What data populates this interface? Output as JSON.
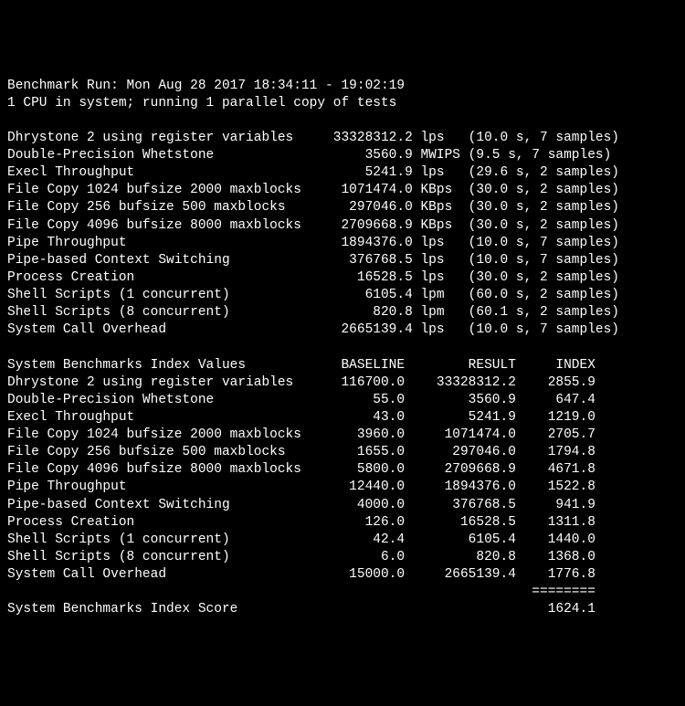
{
  "header": {
    "run_line": "Benchmark Run: Mon Aug 28 2017 18:34:11 - 19:02:19",
    "cpu_line": "1 CPU in system; running 1 parallel copy of tests"
  },
  "raw_results": [
    {
      "name": "Dhrystone 2 using register variables",
      "value": "33328312.2",
      "unit": "lps",
      "time": "10.0 s",
      "samples": "7 samples"
    },
    {
      "name": "Double-Precision Whetstone",
      "value": "3560.9",
      "unit": "MWIPS",
      "time": "9.5 s",
      "samples": "7 samples"
    },
    {
      "name": "Execl Throughput",
      "value": "5241.9",
      "unit": "lps",
      "time": "29.6 s",
      "samples": "2 samples"
    },
    {
      "name": "File Copy 1024 bufsize 2000 maxblocks",
      "value": "1071474.0",
      "unit": "KBps",
      "time": "30.0 s",
      "samples": "2 samples"
    },
    {
      "name": "File Copy 256 bufsize 500 maxblocks",
      "value": "297046.0",
      "unit": "KBps",
      "time": "30.0 s",
      "samples": "2 samples"
    },
    {
      "name": "File Copy 4096 bufsize 8000 maxblocks",
      "value": "2709668.9",
      "unit": "KBps",
      "time": "30.0 s",
      "samples": "2 samples"
    },
    {
      "name": "Pipe Throughput",
      "value": "1894376.0",
      "unit": "lps",
      "time": "10.0 s",
      "samples": "7 samples"
    },
    {
      "name": "Pipe-based Context Switching",
      "value": "376768.5",
      "unit": "lps",
      "time": "10.0 s",
      "samples": "7 samples"
    },
    {
      "name": "Process Creation",
      "value": "16528.5",
      "unit": "lps",
      "time": "30.0 s",
      "samples": "2 samples"
    },
    {
      "name": "Shell Scripts (1 concurrent)",
      "value": "6105.4",
      "unit": "lpm",
      "time": "60.0 s",
      "samples": "2 samples"
    },
    {
      "name": "Shell Scripts (8 concurrent)",
      "value": "820.8",
      "unit": "lpm",
      "time": "60.1 s",
      "samples": "2 samples"
    },
    {
      "name": "System Call Overhead",
      "value": "2665139.4",
      "unit": "lps",
      "time": "10.0 s",
      "samples": "7 samples"
    }
  ],
  "index_header": {
    "label": "System Benchmarks Index Values",
    "baseline": "BASELINE",
    "result": "RESULT",
    "index": "INDEX"
  },
  "index_results": [
    {
      "name": "Dhrystone 2 using register variables",
      "baseline": "116700.0",
      "result": "33328312.2",
      "index": "2855.9"
    },
    {
      "name": "Double-Precision Whetstone",
      "baseline": "55.0",
      "result": "3560.9",
      "index": "647.4"
    },
    {
      "name": "Execl Throughput",
      "baseline": "43.0",
      "result": "5241.9",
      "index": "1219.0"
    },
    {
      "name": "File Copy 1024 bufsize 2000 maxblocks",
      "baseline": "3960.0",
      "result": "1071474.0",
      "index": "2705.7"
    },
    {
      "name": "File Copy 256 bufsize 500 maxblocks",
      "baseline": "1655.0",
      "result": "297046.0",
      "index": "1794.8"
    },
    {
      "name": "File Copy 4096 bufsize 8000 maxblocks",
      "baseline": "5800.0",
      "result": "2709668.9",
      "index": "4671.8"
    },
    {
      "name": "Pipe Throughput",
      "baseline": "12440.0",
      "result": "1894376.0",
      "index": "1522.8"
    },
    {
      "name": "Pipe-based Context Switching",
      "baseline": "4000.0",
      "result": "376768.5",
      "index": "941.9"
    },
    {
      "name": "Process Creation",
      "baseline": "126.0",
      "result": "16528.5",
      "index": "1311.8"
    },
    {
      "name": "Shell Scripts (1 concurrent)",
      "baseline": "42.4",
      "result": "6105.4",
      "index": "1440.0"
    },
    {
      "name": "Shell Scripts (8 concurrent)",
      "baseline": "6.0",
      "result": "820.8",
      "index": "1368.0"
    },
    {
      "name": "System Call Overhead",
      "baseline": "15000.0",
      "result": "2665139.4",
      "index": "1776.8"
    }
  ],
  "score": {
    "label": "System Benchmarks Index Score",
    "value": "1624.1"
  },
  "separator": "========"
}
